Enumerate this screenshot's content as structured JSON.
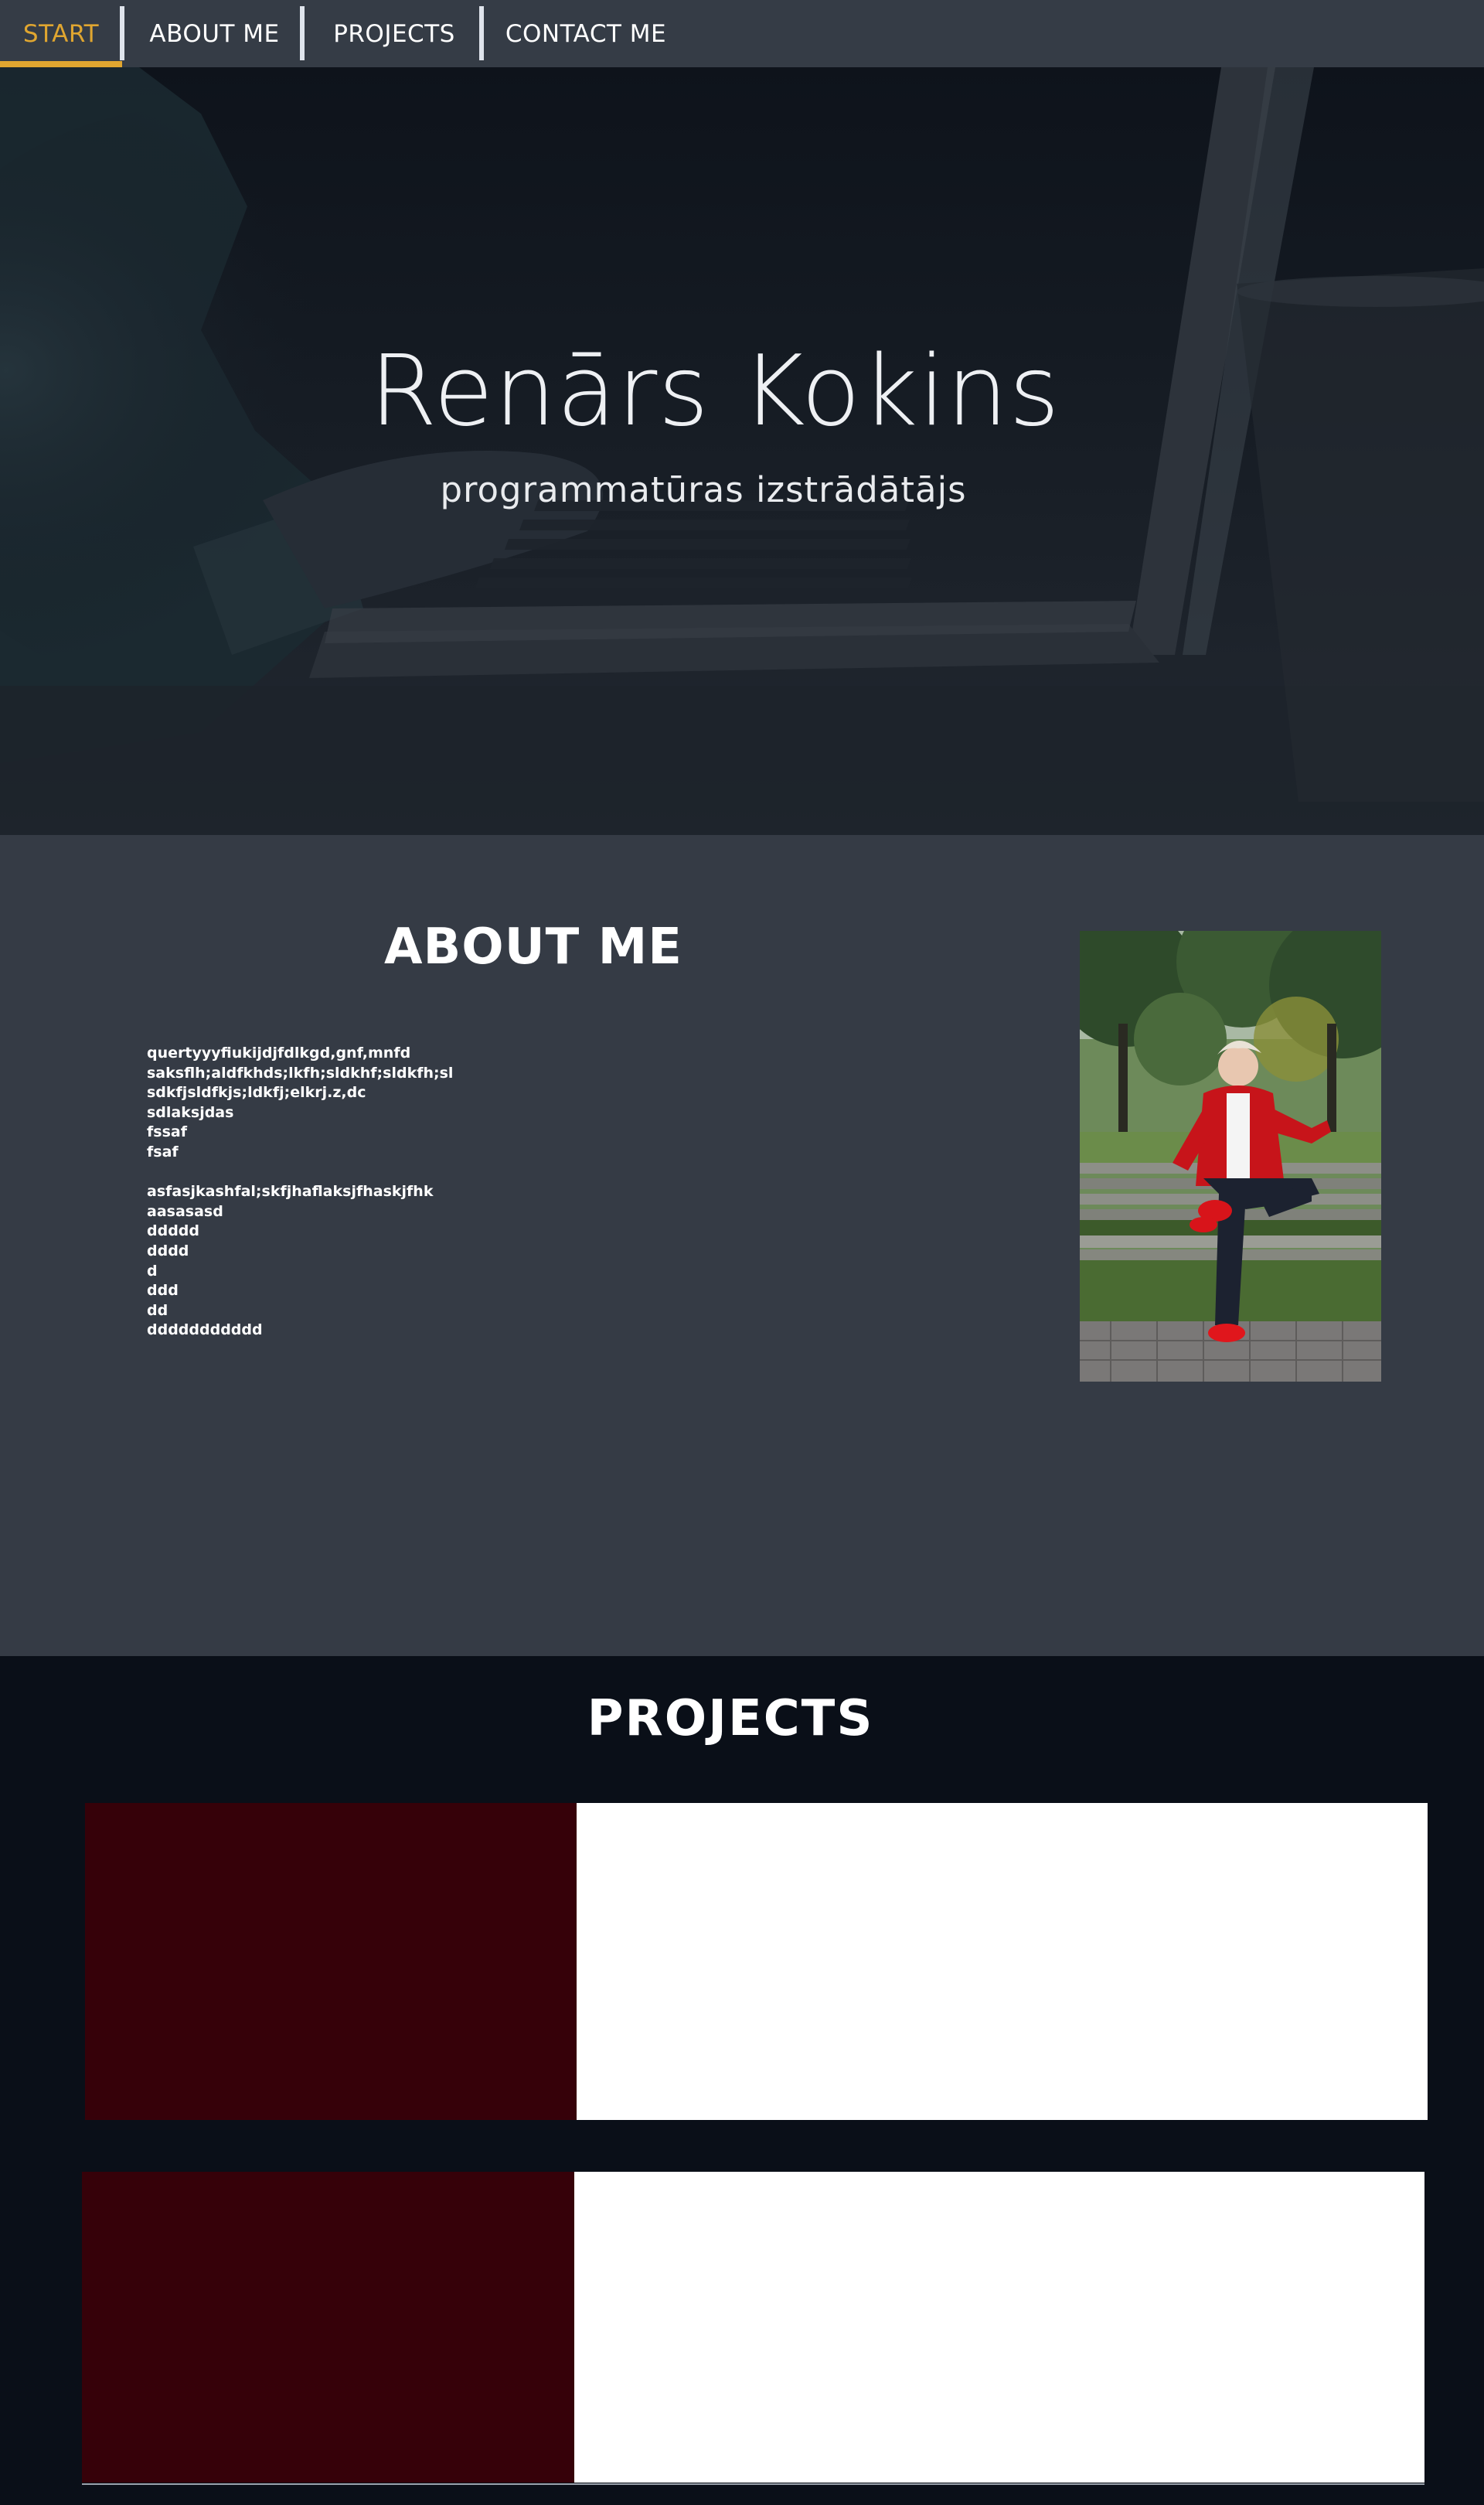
{
  "nav": {
    "items": [
      {
        "label": "START",
        "active": true
      },
      {
        "label": "ABOUT ME",
        "active": false
      },
      {
        "label": "PROJECTS",
        "active": false
      },
      {
        "label": "CONTACT ME",
        "active": false
      }
    ],
    "active_color": "#e0a630"
  },
  "hero": {
    "title": "Renārs Kokins",
    "subtitle": "programmatūras izstrādātājs",
    "background": "laptop-photo"
  },
  "about": {
    "title": "ABOUT ME",
    "lines": [
      "quertyyyfiukijdjfdlkgd,gnf,mnfd",
      "saksflh;aldfkhds;lkfh;sldkhf;sldkfh;sl",
      "sdkfjsldfkjs;ldkfj;elkrj.z,dc",
      "sdlaksjdas",
      "fssaf",
      "fsaf",
      "",
      "asfasjkashfal;skfjhaflaksjfhaskjfhk",
      "aasasasd",
      "ddddd",
      "dddd",
      "d",
      "ddd",
      "dd",
      "ddddddddddd"
    ],
    "photo": "portrait-photo"
  },
  "projects": {
    "title": "PROJECTS",
    "card_colors": {
      "left": "#360109",
      "right": "#ffffff"
    }
  }
}
